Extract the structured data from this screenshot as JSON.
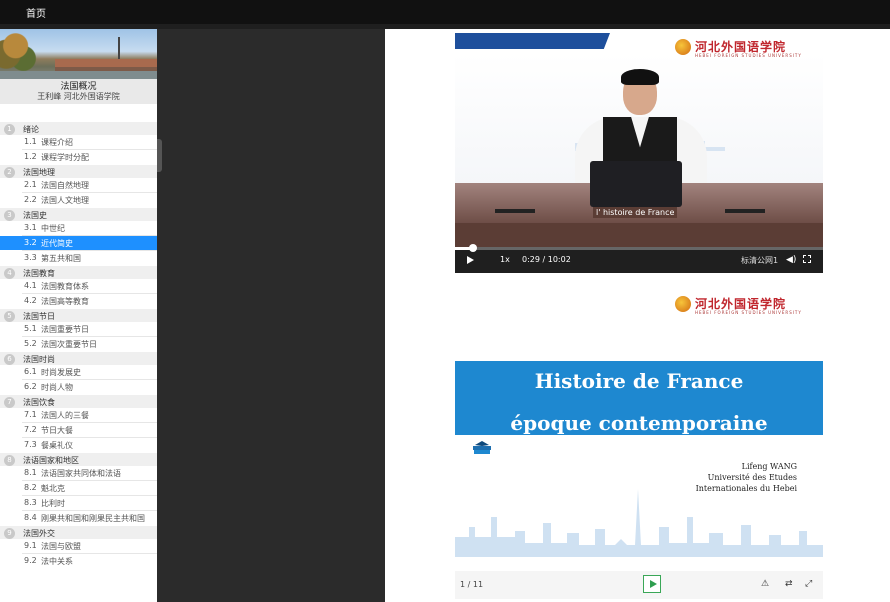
{
  "topbar": {
    "home_label": "首页"
  },
  "course": {
    "name": "法国概况",
    "teacher": "王利峰 河北外国语学院"
  },
  "toc": [
    {
      "num": "1",
      "title": "绪论",
      "sections": [
        {
          "num": "1.1",
          "title": "课程介绍"
        },
        {
          "num": "1.2",
          "title": "课程学时分配"
        }
      ]
    },
    {
      "num": "2",
      "title": "法国地理",
      "sections": [
        {
          "num": "2.1",
          "title": "法国自然地理"
        },
        {
          "num": "2.2",
          "title": "法国人文地理"
        }
      ]
    },
    {
      "num": "3",
      "title": "法国史",
      "sections": [
        {
          "num": "3.1",
          "title": "中世纪"
        },
        {
          "num": "3.2",
          "title": "近代简史",
          "active": true
        },
        {
          "num": "3.3",
          "title": "第五共和国"
        }
      ]
    },
    {
      "num": "4",
      "title": "法国教育",
      "sections": [
        {
          "num": "4.1",
          "title": "法国教育体系"
        },
        {
          "num": "4.2",
          "title": "法国高等教育"
        }
      ]
    },
    {
      "num": "5",
      "title": "法国节日",
      "sections": [
        {
          "num": "5.1",
          "title": "法国重要节日"
        },
        {
          "num": "5.2",
          "title": "法国次重要节日"
        }
      ]
    },
    {
      "num": "6",
      "title": "法国时尚",
      "sections": [
        {
          "num": "6.1",
          "title": "时尚发展史"
        },
        {
          "num": "6.2",
          "title": "时尚人物"
        }
      ]
    },
    {
      "num": "7",
      "title": "法国饮食",
      "sections": [
        {
          "num": "7.1",
          "title": "法国人的三餐"
        },
        {
          "num": "7.2",
          "title": "节日大餐"
        },
        {
          "num": "7.3",
          "title": "餐桌礼仪"
        }
      ]
    },
    {
      "num": "8",
      "title": "法语国家和地区",
      "sections": [
        {
          "num": "8.1",
          "title": "法语国家共同体和法语"
        },
        {
          "num": "8.2",
          "title": "魁北克"
        },
        {
          "num": "8.3",
          "title": "比利时"
        },
        {
          "num": "8.4",
          "title": "刚果共和国和刚果民主共和国"
        }
      ]
    },
    {
      "num": "9",
      "title": "法国外交",
      "sections": [
        {
          "num": "9.1",
          "title": "法国与欧盟"
        },
        {
          "num": "9.2",
          "title": "法中关系"
        }
      ]
    }
  ],
  "video": {
    "logo_text": "河北外国语学院",
    "logo_sub": "HEBEI FOREIGN STUDIES UNIVERSITY",
    "nameplate": "l' histoire de France",
    "speed": "1x",
    "time": "0:29 / 10:02",
    "quality": "标清公网1",
    "progress": 0.048
  },
  "slide": {
    "logo_text": "河北外国语学院",
    "logo_sub": "HEBEI FOREIGN STUDIES UNIVERSITY",
    "title_line1": "Histoire de France",
    "title_line2": "époque contemporaine",
    "author_line1": "Lifeng WANG",
    "author_line2": "Université des Etudes",
    "author_line3": "Internationales du Hebei",
    "page": "1 / 11"
  }
}
